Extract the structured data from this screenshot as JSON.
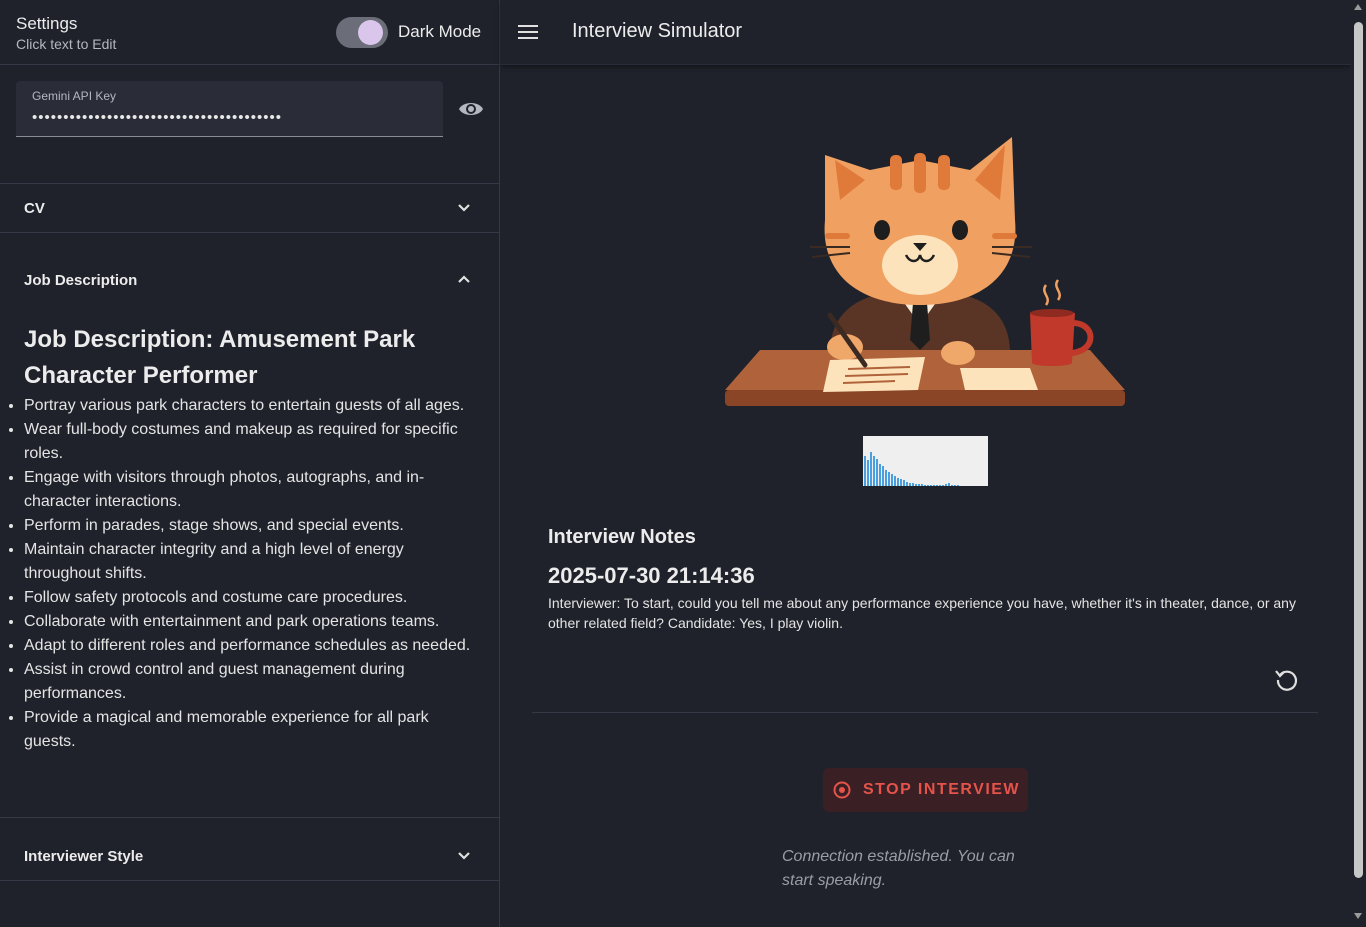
{
  "settings": {
    "title": "Settings",
    "subtitle": "Click text to Edit",
    "dark_mode_label": "Dark Mode",
    "dark_mode_on": true
  },
  "api_key": {
    "label": "Gemini API Key",
    "value": "••••••••••••••••••••••••••••••••••••••••"
  },
  "accordions": {
    "cv": {
      "label": "CV",
      "expanded": false
    },
    "job_description": {
      "label": "Job Description",
      "expanded": true,
      "heading": "Job Description: Amusement Park Character Performer",
      "items": [
        "Portray various park characters to entertain guests of all ages.",
        "Wear full-body costumes and makeup as required for specific roles.",
        "Engage with visitors through photos, autographs, and in-character interactions.",
        "Perform in parades, stage shows, and special events.",
        "Maintain character integrity and a high level of energy throughout shifts.",
        "Follow safety protocols and costume care procedures.",
        "Collaborate with entertainment and park operations teams.",
        "Adapt to different roles and performance schedules as needed.",
        "Assist in crowd control and guest management during performances.",
        "Provide a magical and memorable experience for all park guests."
      ]
    },
    "interviewer_style": {
      "label": "Interviewer Style",
      "expanded": false
    }
  },
  "header": {
    "title": "Interview Simulator",
    "menu_icon": "menu-icon"
  },
  "notes": {
    "title": "Interview Notes",
    "date": "2025-07-30 21:14:36",
    "text": "Interviewer: To start, could you tell me about any performance experience you have, whether it's in theater, dance, or any other related field? Candidate: Yes, I play violin."
  },
  "actions": {
    "stop_label": "STOP INTERVIEW",
    "status": "Connection established. You can start speaking."
  },
  "colors": {
    "background": "#1f222b",
    "accent_stop": "#e5534b",
    "waveform_bar": "#4a9fe0"
  }
}
